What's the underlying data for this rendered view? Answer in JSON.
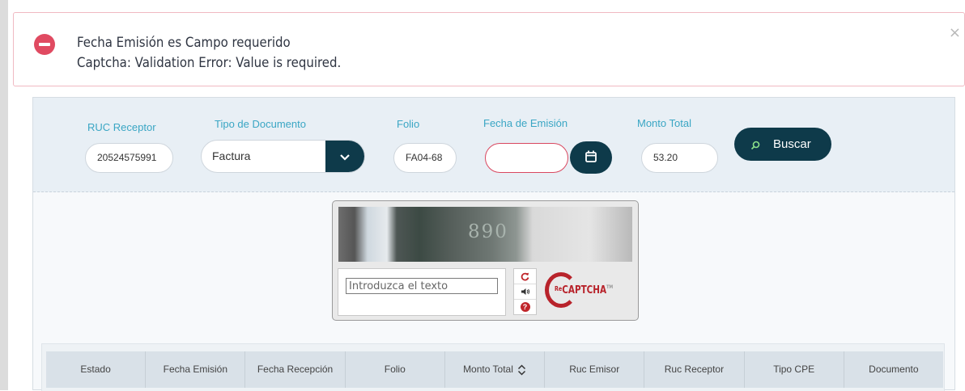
{
  "alert": {
    "line1": "Fecha Emisión es Campo requerido",
    "line2": "Captcha: Validation Error: Value is required.",
    "close": "×"
  },
  "filters": {
    "ruc_label": "RUC Receptor",
    "ruc_value": "20524575991",
    "tipo_label": "Tipo de Documento",
    "tipo_value": "Factura",
    "folio_label": "Folio",
    "folio_value": "FA04-68",
    "fecha_label": "Fecha de Emisión",
    "fecha_value": "",
    "monto_label": "Monto Total",
    "monto_value": "53.20",
    "search_label": "Buscar"
  },
  "captcha": {
    "challenge_text": "890",
    "placeholder": "Introduzca el texto",
    "logo_text": "CAPTCHA",
    "logo_prefix": "Re",
    "logo_tm": "TM"
  },
  "table": {
    "headers": [
      "Estado",
      "Fecha Emisión",
      "Fecha Recepción",
      "Folio",
      "Monto Total",
      "Ruc Emisor",
      "Ruc Receptor",
      "Tipo CPE",
      "Documento"
    ]
  },
  "colors": {
    "accent": "#0e3a4a",
    "error": "#e04a61",
    "label": "#3aa6c4"
  }
}
